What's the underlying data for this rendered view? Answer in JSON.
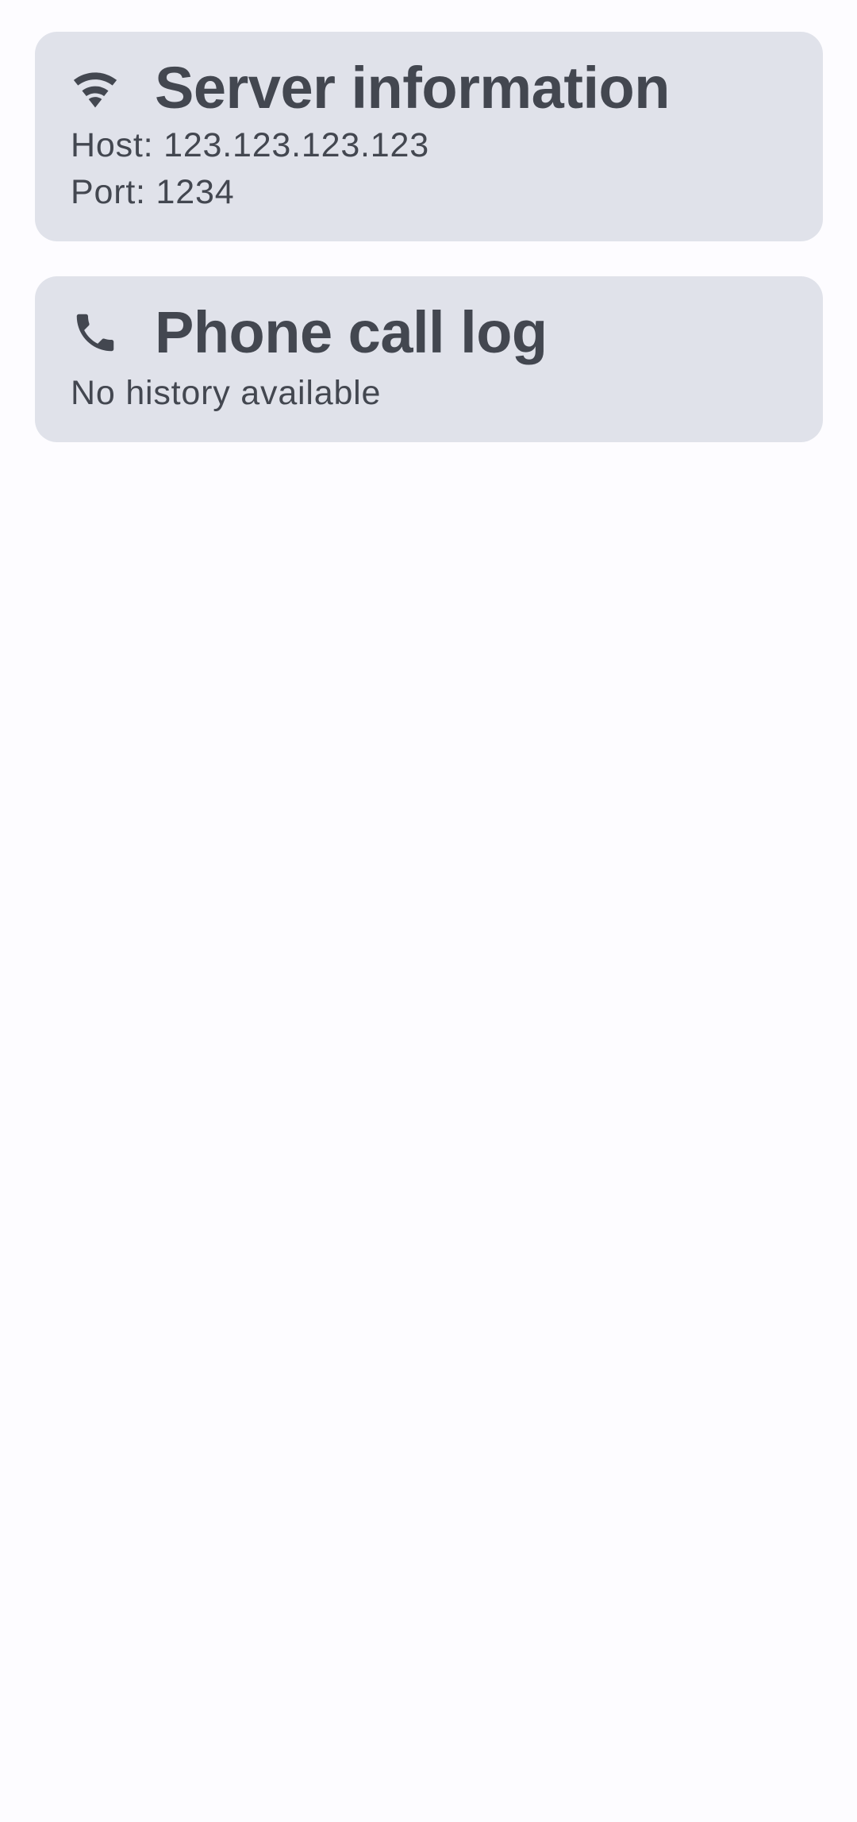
{
  "colors": {
    "background": "#fdfcff",
    "card_background": "#e0e2ea",
    "text": "#434750"
  },
  "server_card": {
    "icon": "wifi-icon",
    "title": "Server information",
    "host_line": "Host: 123.123.123.123",
    "port_line": "Port: 1234"
  },
  "call_log_card": {
    "icon": "phone-icon",
    "title": "Phone call log",
    "empty_text": "No history available"
  }
}
